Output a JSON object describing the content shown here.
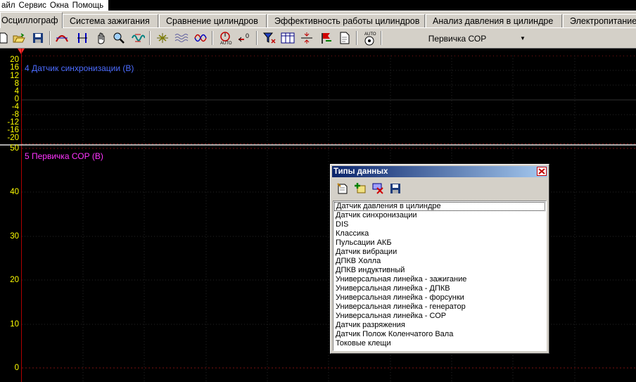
{
  "menu": [
    "айл",
    "Сервис",
    "Окна",
    "Помощь"
  ],
  "tabs": [
    "Осциллограф",
    "Система зажигания",
    "Сравнение цилиндров",
    "Эффективность работы цилиндров",
    "Анализ давления в цилиндре",
    "Электропитание"
  ],
  "toolbar": {
    "channel_select": "Первичка СОР",
    "icons": [
      "new-icon",
      "open-icon",
      "save-icon",
      "curve-icon",
      "cursor-icon",
      "hand-icon",
      "zoom-icon",
      "signal-icon",
      "filter-icon",
      "wave-icon",
      "wave2-icon",
      "auto-icon",
      "zero-icon",
      "funnel-icon",
      "grid-icon",
      "split-icon",
      "flag-icon",
      "page-icon",
      "auto-scale-icon"
    ]
  },
  "channel1": {
    "label": "4 Датчик синхронизации (В)",
    "color": "#4b6bff",
    "ticks": [
      "20",
      "16",
      "12",
      "8",
      "4",
      "0",
      "-4",
      "-8",
      "-12",
      "-16",
      "-20"
    ]
  },
  "channel2": {
    "label": "5 Первичка СОР (В)",
    "color": "#ff33ff",
    "ticks": [
      "50",
      "40",
      "30",
      "20",
      "10",
      "0"
    ]
  },
  "dialog": {
    "title": "Типы данных",
    "items": [
      "Датчик давления в цилиндре",
      "Датчик синхронизации",
      "DIS",
      "Классика",
      "Пульсации АКБ",
      "Датчик вибрации",
      "ДПКВ Холла",
      "ДПКВ индуктивный",
      "Универсальная линейка - зажигание",
      "Универсальная линейка - ДПКВ",
      "Универсальная линейка - форсунки",
      "Универсальная линейка - генератор",
      "Универсальная линейка - СОР",
      "Датчик разряжения",
      "Датчик Полож Коленчатого Вала",
      "Токовые клещи"
    ]
  }
}
